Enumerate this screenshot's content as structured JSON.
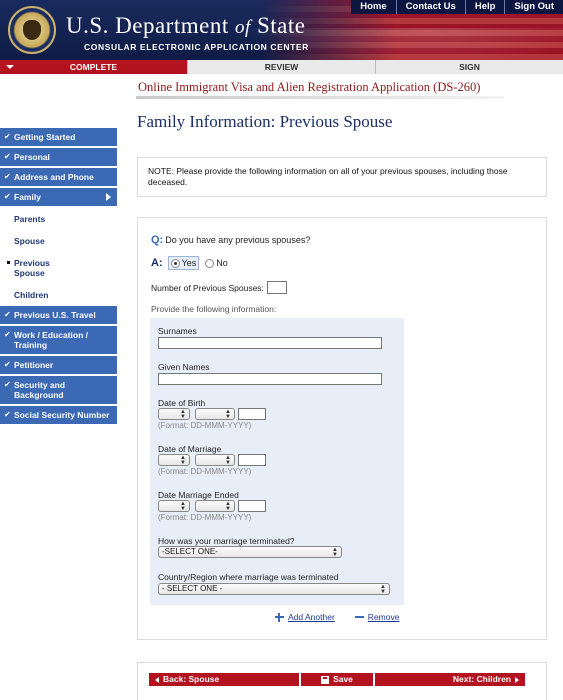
{
  "header": {
    "title_part1": "U.S. Department ",
    "title_of": "of",
    "title_part2": " State",
    "subtitle": "CONSULAR ELECTRONIC APPLICATION CENTER",
    "nav": [
      "Home",
      "Contact Us",
      "Help",
      "Sign Out"
    ]
  },
  "steps": {
    "complete": "COMPLETE",
    "review": "REVIEW",
    "sign": "SIGN"
  },
  "form_title": "Online Immigrant Visa and Alien Registration Application (DS-260)",
  "sidebar": {
    "items": [
      {
        "label": "Getting Started"
      },
      {
        "label": "Personal"
      },
      {
        "label": "Address and Phone"
      },
      {
        "label": "Family"
      }
    ],
    "subitems": [
      "Parents",
      "Spouse",
      "Previous Spouse",
      "Children"
    ],
    "items_after": [
      {
        "label": "Previous U.S. Travel"
      },
      {
        "label": "Work / Education / Training"
      },
      {
        "label": "Petitioner"
      },
      {
        "label": "Security and Background"
      },
      {
        "label": "Social Security Number"
      }
    ]
  },
  "page_title": "Family Information: Previous Spouse",
  "note": "NOTE: Please provide the following information on all of your previous spouses, including those deceased.",
  "question": {
    "q_letter": "Q:",
    "q_text": "Do you have any previous spouses?",
    "a_letter": "A:",
    "yes_label": "Yes",
    "no_label": "No",
    "selected": "Yes"
  },
  "num_previous_label": "Number of Previous Spouses:",
  "num_previous_value": "",
  "provide_label": "Provide the following information:",
  "spouse": {
    "surnames_label": "Surnames",
    "surnames_value": "",
    "given_label": "Given Names",
    "given_value": "",
    "dob_label": "Date of Birth",
    "dom_label": "Date of Marriage",
    "dme_label": "Date Marriage Ended",
    "date_format": "(Format: DD-MMM-YYYY)",
    "terminated_label": "How was your marriage terminated?",
    "terminated_value": "-SELECT ONE-",
    "country_label": "Country/Region where marriage was terminated",
    "country_value": "- SELECT ONE -"
  },
  "links": {
    "add": "Add Another",
    "remove": "Remove"
  },
  "buttons": {
    "back": "Back: Spouse",
    "save": "Save",
    "next": "Next: Children"
  },
  "colors": {
    "brand_red": "#b3121f",
    "nav_blue": "#3b69b3",
    "title_navy": "#1b2f66"
  }
}
